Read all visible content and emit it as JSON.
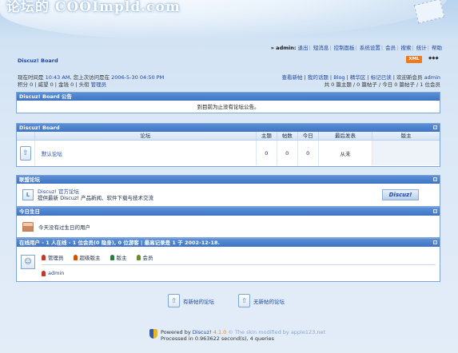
{
  "header": {
    "logo_text": "论坛的 COOImpld.com"
  },
  "topnav": {
    "user": "» admin:",
    "items": [
      "退出",
      "短消息",
      "控制面板",
      "系统设置",
      "会员",
      "搜索",
      "统计",
      "帮助"
    ]
  },
  "forum_title": "Discuz! Board",
  "xml_badge": "XML",
  "window_buttons": "◆◆◆",
  "info_left": {
    "line1_prefix": "现在时间是",
    "line1_time": "10:43 AM",
    "line1_mid": ", 您上次访问是在",
    "line1_last": "2006-5-30 04:50 PM",
    "line2": "积分 0 | 威望 0 | 金钱 0 | 头衔",
    "line2_title": "管理员"
  },
  "info_right": {
    "links": [
      "查看新帖",
      "我的话题",
      "Blog",
      "精华区",
      "标记已读",
      "欢迎新会员"
    ],
    "new_member": "admin",
    "stats": "共 0 篇主题 / 0 篇帖子 / 今日 0 篇帖子 / 1 位会员"
  },
  "announcement": {
    "title": "Discuz! Board 公告",
    "text": "到目前为止没有论坛公告。"
  },
  "board": {
    "title": "Discuz! Board",
    "columns": [
      "论坛",
      "主题",
      "帖数",
      "今日",
      "最后发表",
      "版主"
    ],
    "forums": [
      {
        "name": "默认论坛",
        "topics": "0",
        "posts": "0",
        "today": "0",
        "last": "从未",
        "mod": ""
      }
    ]
  },
  "links": {
    "title": "联盟论坛",
    "name": "Discuz! 官方论坛",
    "desc": "提供最新 Discuz! 产品新闻、软件下载与技术交流",
    "logo_text": "Discuz!"
  },
  "birthday": {
    "title": "今日生日",
    "text": "今天没有过生日的用户"
  },
  "online": {
    "title": "在线用户 - 1 人在线 - 1 位会员(0 隐身), 0 位游客 | 最高记录是 1 于 2002-12-18.",
    "legend": [
      {
        "label": "管理员",
        "color": "#c0392b"
      },
      {
        "label": "超级版主",
        "color": "#d35400"
      },
      {
        "label": "版主",
        "color": "#2c7a3f"
      },
      {
        "label": "会员",
        "color": "#6b8e23"
      }
    ],
    "members": [
      "admin"
    ]
  },
  "actions": {
    "new_posts": "有新帖的论坛",
    "no_new_posts": "无新帖的论坛"
  },
  "footer": {
    "powered": "Powered by",
    "product": "Discuz!",
    "version": "4.1.0",
    "theme": "© The skin modified by apple123.net",
    "processed": "Processed in 0.963622 second(s), 4 queries"
  }
}
